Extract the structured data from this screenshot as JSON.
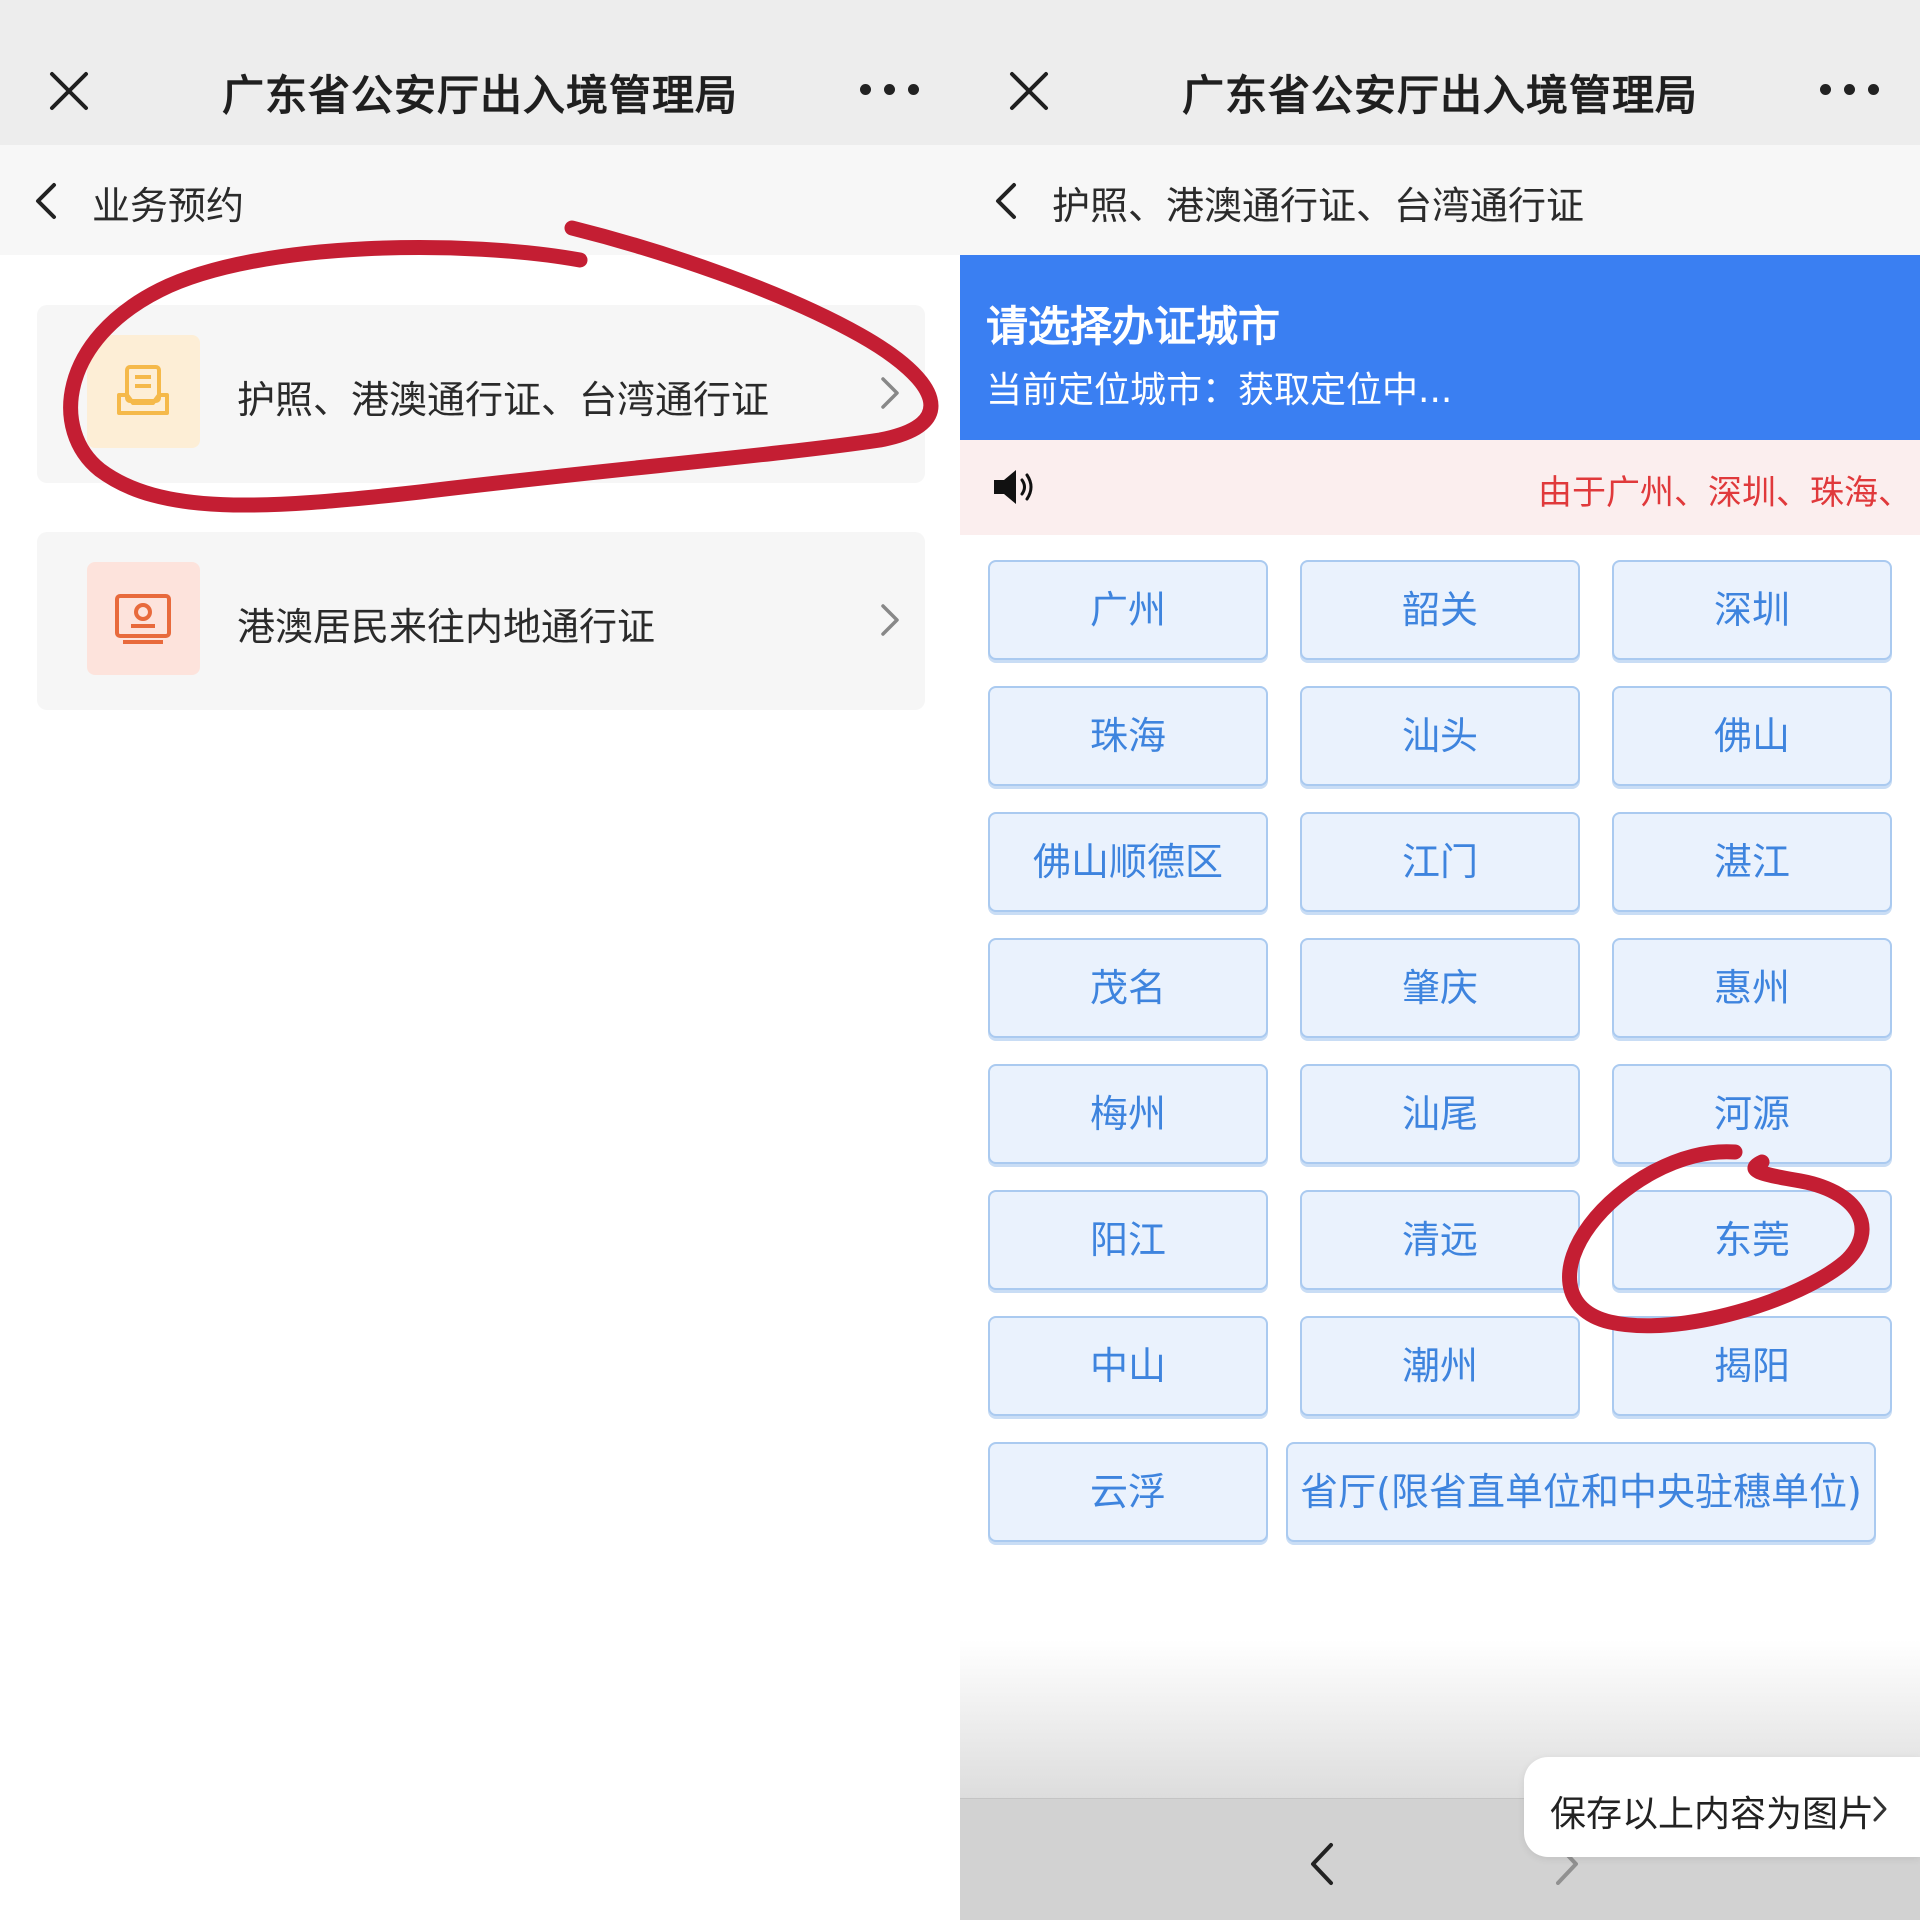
{
  "left": {
    "titlebar": {
      "title": "广东省公安厅出入境管理局",
      "close_icon": "close-icon",
      "more_icon": "more-icon"
    },
    "navbar": {
      "title": "业务预约",
      "back_icon": "chevron-left-icon"
    },
    "services": [
      {
        "label": "护照、港澳通行证、台湾通行证",
        "icon": "document-icon",
        "icon_bg": "#fdeed6",
        "icon_color": "#f5b94a"
      },
      {
        "label": "港澳居民来往内地通行证",
        "icon": "id-card-icon",
        "icon_bg": "#fde3dc",
        "icon_color": "#e86a3c"
      }
    ]
  },
  "right": {
    "titlebar": {
      "title": "广东省公安厅出入境管理局",
      "close_icon": "close-icon",
      "more_icon": "more-icon"
    },
    "navbar": {
      "title": "护照、港澳通行证、台湾通行证",
      "back_icon": "chevron-left-icon"
    },
    "header": {
      "title": "请选择办证城市",
      "location": "当前定位城市：获取定位中..."
    },
    "notice": {
      "icon": "speaker-icon",
      "text": "由于广州、深圳、珠海、"
    },
    "cities": [
      "广州",
      "韶关",
      "深圳",
      "珠海",
      "汕头",
      "佛山",
      "佛山顺德区",
      "江门",
      "湛江",
      "茂名",
      "肇庆",
      "惠州",
      "梅州",
      "汕尾",
      "河源",
      "阳江",
      "清远",
      "东莞",
      "中山",
      "潮州",
      "揭阳",
      "云浮",
      "省厅(限省直单位和中央驻穗单位)"
    ],
    "bottom": {
      "save_label": "保存以上内容为图片",
      "back_icon": "chevron-left-icon",
      "forward_icon": "chevron-right-icon"
    }
  },
  "colors": {
    "accent_blue": "#3a7ff2",
    "city_text": "#3e84de",
    "notice_red": "#e0393b",
    "annotation_red": "#c41e33"
  },
  "annotations": [
    {
      "type": "hand-drawn-circle",
      "target": "护照、港澳通行证、台湾通行证",
      "color": "#c41e33"
    },
    {
      "type": "hand-drawn-circle",
      "target": "东莞",
      "color": "#c41e33"
    }
  ]
}
